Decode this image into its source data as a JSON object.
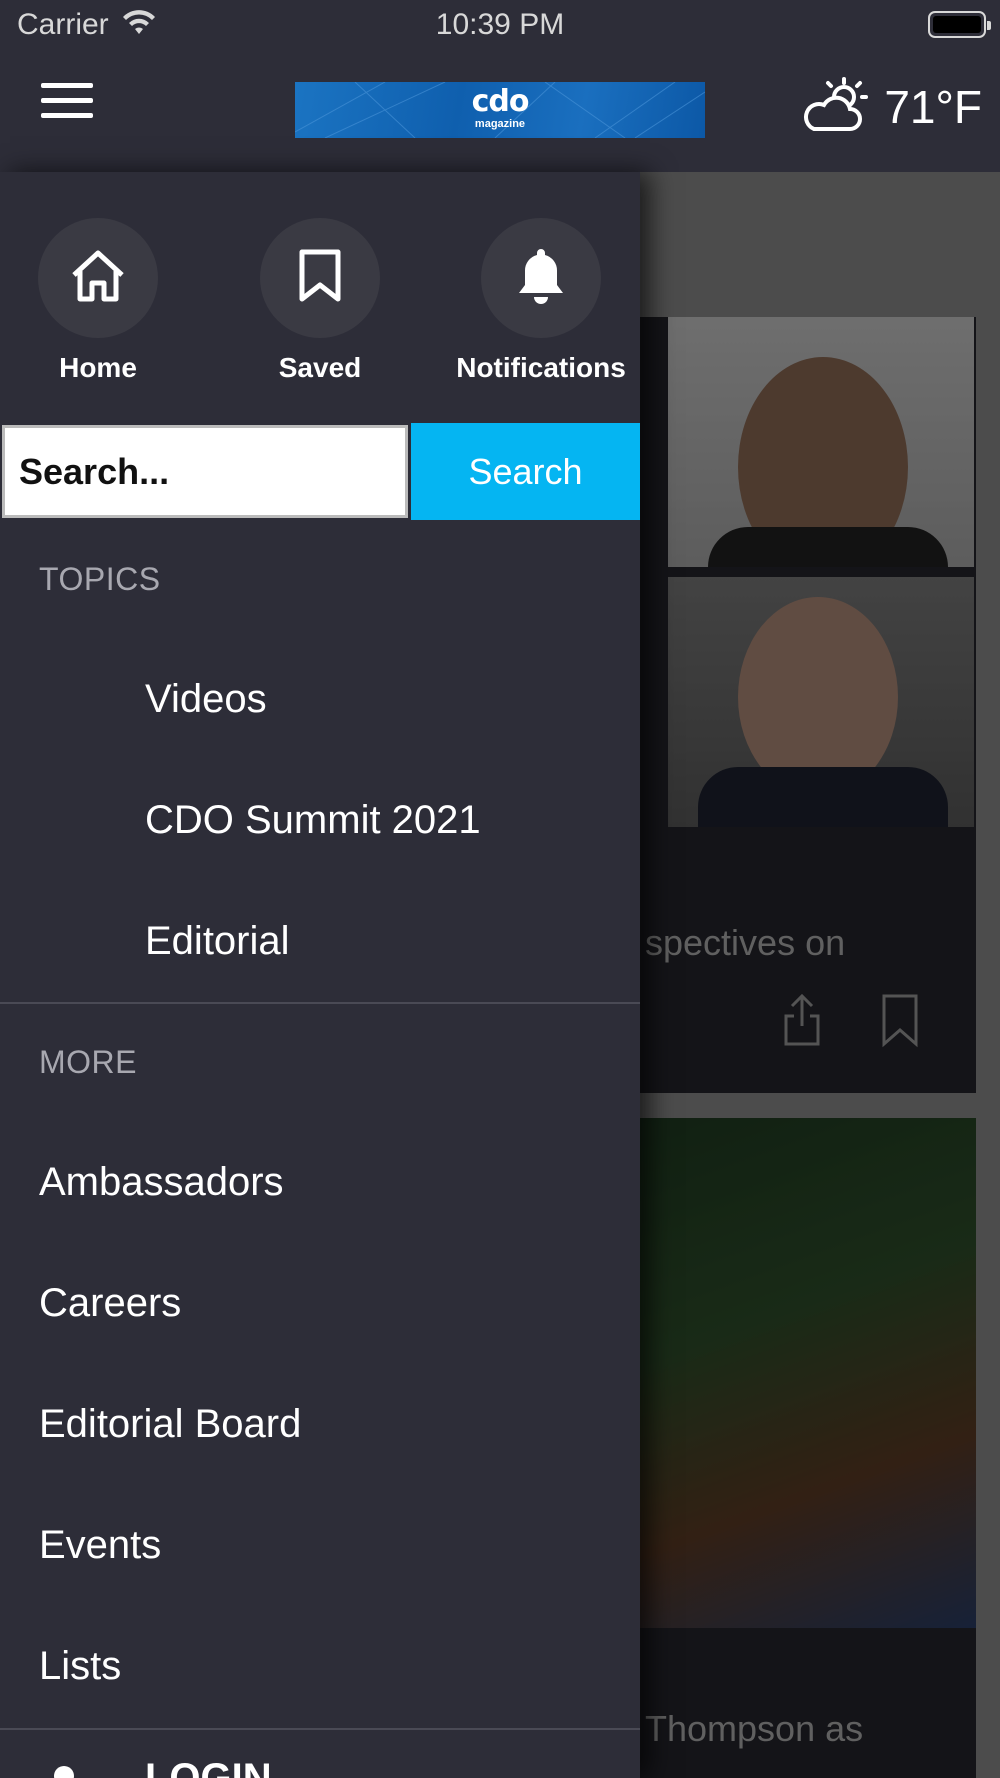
{
  "status_bar": {
    "carrier": "Carrier",
    "time": "10:39 PM"
  },
  "navbar": {
    "logo_main": "cdo",
    "logo_sub": "magazine",
    "weather_icon": "partly-cloudy-icon",
    "temperature": "71°F"
  },
  "drawer": {
    "quick_actions": [
      {
        "label": "Home",
        "icon": "home-icon"
      },
      {
        "label": "Saved",
        "icon": "bookmark-icon"
      },
      {
        "label": "Notifications",
        "icon": "bell-icon"
      }
    ],
    "search": {
      "placeholder": "Search...",
      "button_label": "Search"
    },
    "topics": {
      "title": "TOPICS",
      "items": [
        "Videos",
        "CDO Summit 2021",
        "Editorial"
      ]
    },
    "more": {
      "title": "MORE",
      "items": [
        "Ambassadors",
        "Careers",
        "Editorial Board",
        "Events",
        "Lists"
      ]
    },
    "login_label": "LOGIN"
  },
  "background_feed": {
    "card1_snippet": "spectives on",
    "card2_snippet": "Thompson as"
  },
  "colors": {
    "background": "#2d2d38",
    "search_button": "#05b5f2",
    "section_title": "#a8a8b0"
  }
}
